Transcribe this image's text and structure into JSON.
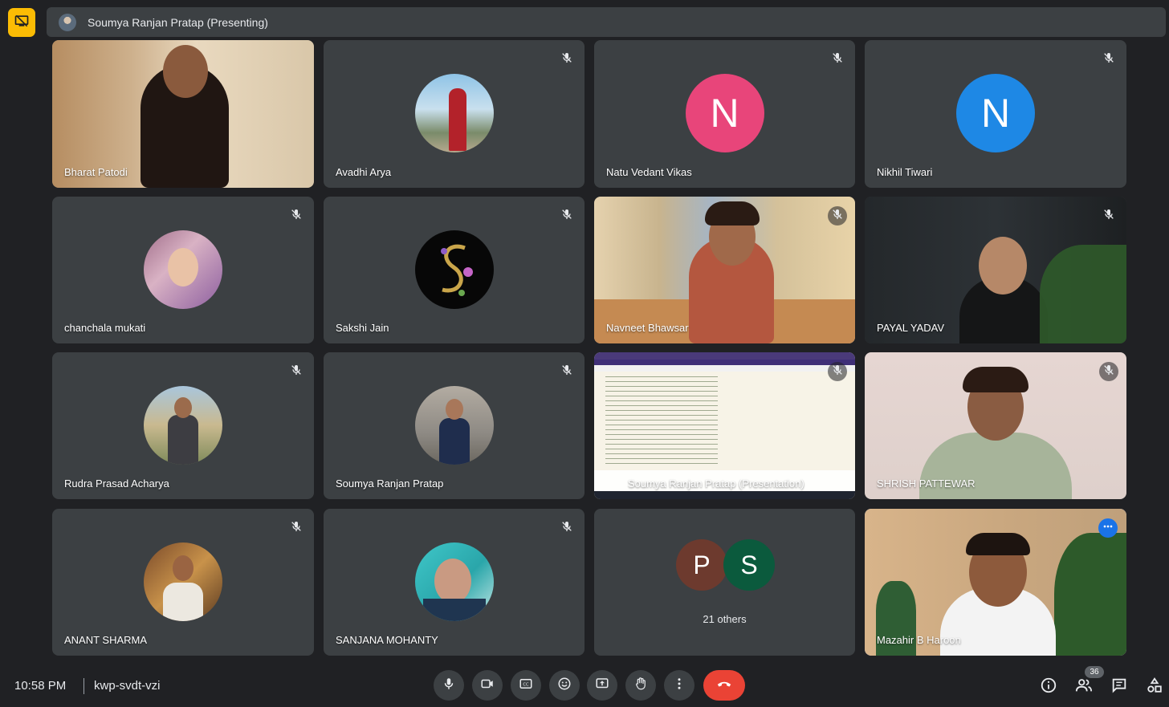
{
  "presenter": {
    "name": "Soumya Ranjan Pratap (Presenting)"
  },
  "tiles": [
    {
      "name": "Bharat Patodi"
    },
    {
      "name": "Avadhi Arya"
    },
    {
      "name": "Natu Vedant Vikas",
      "initial": "N",
      "color": "#e8457a"
    },
    {
      "name": "Nikhil Tiwari",
      "initial": "N",
      "color": "#1e88e5"
    },
    {
      "name": "chanchala mukati"
    },
    {
      "name": "Sakshi Jain"
    },
    {
      "name": "Navneet Bhawsar"
    },
    {
      "name": "PAYAL YADAV"
    },
    {
      "name": "Rudra Prasad Acharya"
    },
    {
      "name": "Soumya Ranjan Pratap"
    },
    {
      "name": "Soumya Ranjan Pratap (Presentation)"
    },
    {
      "name": "SHRISH PATTEWAR"
    },
    {
      "name": "ANANT SHARMA"
    },
    {
      "name": "SANJANA MOHANTY"
    },
    {
      "name": "Mazahir B Haroon"
    }
  ],
  "others": {
    "label": "21 others",
    "circles": [
      {
        "letter": "P",
        "color": "#6d3a2e"
      },
      {
        "letter": "S",
        "color": "#0b5a3d"
      }
    ]
  },
  "footer": {
    "time": "10:58 PM",
    "meeting_code": "kwp-svdt-vzi",
    "participant_count": "36"
  },
  "icons": {
    "badge": "screen-share-off-icon",
    "mute": "mic-off-icon",
    "controls": [
      "mic-icon",
      "camera-icon",
      "captions-icon",
      "emoji-icon",
      "present-icon",
      "raise-hand-icon",
      "more-vert-icon",
      "end-call-icon"
    ],
    "right": [
      "info-icon",
      "people-icon",
      "chat-icon",
      "activities-icon"
    ]
  }
}
